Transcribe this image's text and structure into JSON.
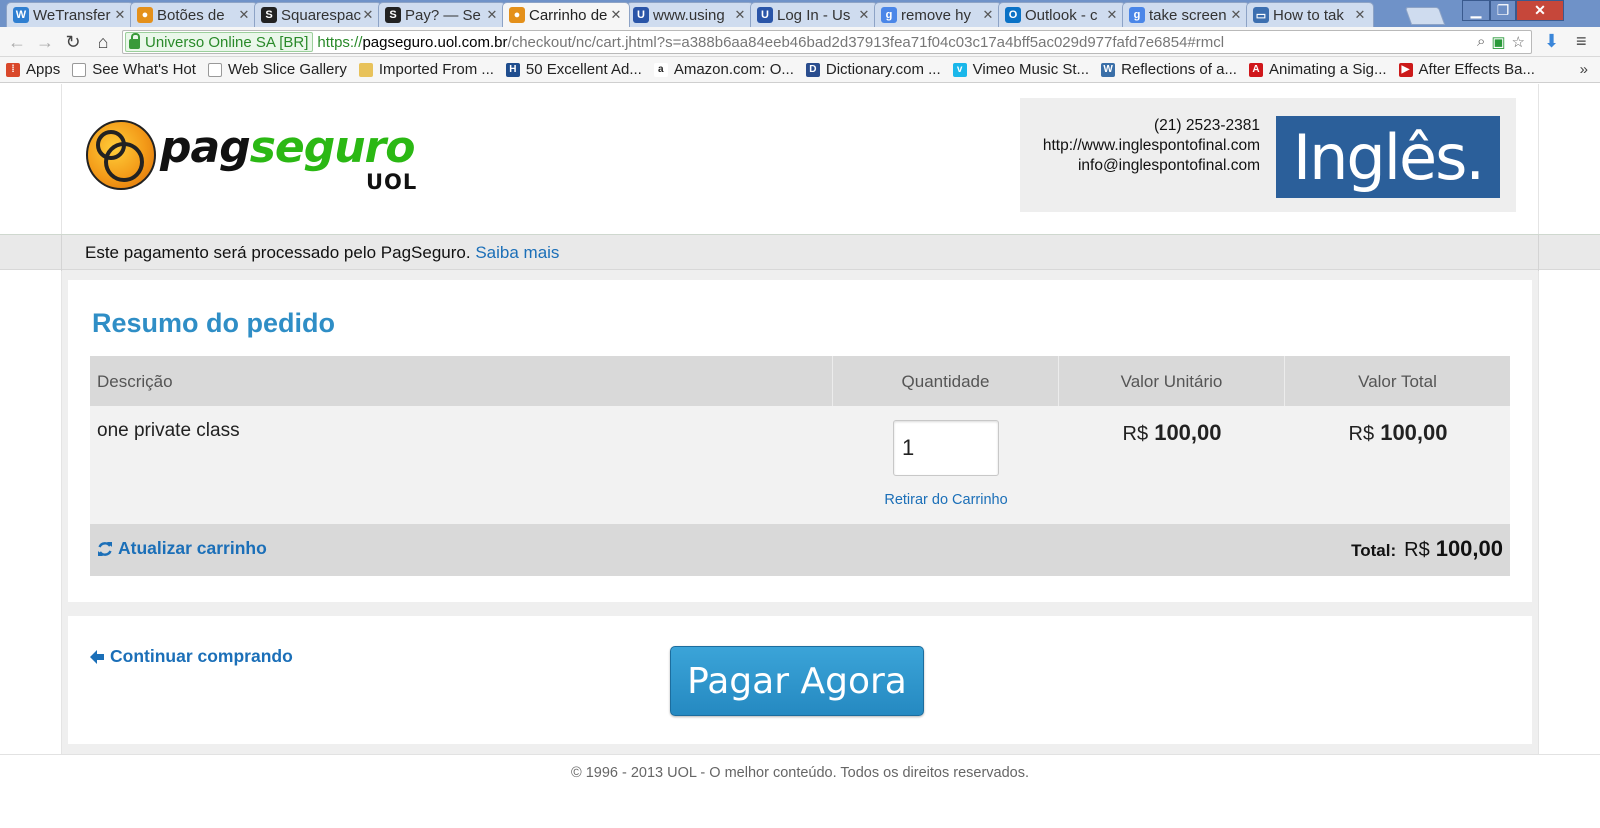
{
  "browser": {
    "tabs": [
      {
        "title": "WeTransfer",
        "favicon": "wetransfer-icon",
        "color": "#2f7fd1"
      },
      {
        "title": "Botões de",
        "favicon": "pagseguro-icon",
        "color": "#e4901a"
      },
      {
        "title": "Squarespace",
        "favicon": "squarespace-icon",
        "color": "#222222"
      },
      {
        "title": "Pay? — Se",
        "favicon": "squarespace-icon",
        "color": "#222222"
      },
      {
        "title": "Carrinho de",
        "favicon": "pagseguro-icon",
        "color": "#e4901a",
        "active": true
      },
      {
        "title": "www.using",
        "favicon": "ue-icon",
        "color": "#2a55a8"
      },
      {
        "title": "Log In - Us",
        "favicon": "ue-icon",
        "color": "#2a55a8"
      },
      {
        "title": "remove hy",
        "favicon": "google-icon",
        "color": "#4a86e8"
      },
      {
        "title": "Outlook - c",
        "favicon": "outlook-icon",
        "color": "#0a72c6"
      },
      {
        "title": "take screen",
        "favicon": "google-icon",
        "color": "#4a86e8"
      },
      {
        "title": "How to tak",
        "favicon": "page-icon",
        "color": "#3c6fb0"
      }
    ],
    "address": {
      "ev_label": "Universo Online SA [BR]",
      "scheme": "https://",
      "host": "pagseguro.uol.com.br",
      "path": "/checkout/nc/cart.jhtml?s=a388b6aa84eeb46bad2d37913fea71f04c03c17a4bff5ac029d977fafd7e6854#rmcl"
    },
    "bookmarks": [
      {
        "label": "Apps",
        "icon": "apps-grid-icon",
        "color": "#d9482b"
      },
      {
        "label": "See What's Hot",
        "icon": "page-icon",
        "color": "#ffffff"
      },
      {
        "label": "Web Slice Gallery",
        "icon": "page-icon",
        "color": "#ffffff"
      },
      {
        "label": "Imported From ...",
        "icon": "folder-icon",
        "color": "#e8c25a"
      },
      {
        "label": "50 Excellent Ad...",
        "icon": "h-icon",
        "color": "#1f4d8e"
      },
      {
        "label": "Amazon.com: O...",
        "icon": "amazon-icon",
        "color": "#222222"
      },
      {
        "label": "Dictionary.com ...",
        "icon": "dictionary-icon",
        "color": "#2a4d8e"
      },
      {
        "label": "Vimeo Music St...",
        "icon": "vimeo-icon",
        "color": "#1ab7ea"
      },
      {
        "label": "Reflections of a...",
        "icon": "wordpress-icon",
        "color": "#3a6fa8"
      },
      {
        "label": "Animating a Sig...",
        "icon": "adobe-icon",
        "color": "#d0171b"
      },
      {
        "label": "After Effects Ba...",
        "icon": "youtube-icon",
        "color": "#cc1a1a"
      }
    ],
    "bookmarks_more": "»"
  },
  "header": {
    "logo_pag": "pag",
    "logo_seguro": "seguro",
    "logo_uol": "UOL",
    "merchant": {
      "phone": "(21) 2523-2381",
      "website": "http://www.inglespontofinal.com",
      "email": "info@inglespontofinal.com",
      "banner_text": "Inglês."
    }
  },
  "notice": {
    "text": "Este pagamento será processado pelo PagSeguro.",
    "link": "Saiba mais"
  },
  "summary": {
    "title": "Resumo do pedido",
    "columns": [
      "Descrição",
      "Quantidade",
      "Valor Unitário",
      "Valor Total"
    ],
    "items": [
      {
        "description": "one private class",
        "quantity": "1",
        "unit_currency": "R$",
        "unit_amount": "100,00",
        "total_currency": "R$",
        "total_amount": "100,00",
        "remove_label": "Retirar do Carrinho"
      }
    ],
    "update_label": "Atualizar carrinho",
    "total_label": "Total:",
    "total_currency": "R$",
    "total_amount": "100,00"
  },
  "actions": {
    "continue_label": "Continuar comprando",
    "pay_label": "Pagar Agora"
  },
  "footer": {
    "text": "© 1996 - 2013 UOL - O melhor conteúdo. Todos os direitos reservados."
  },
  "colors": {
    "accent": "#2f8ec6",
    "link": "#1b6fb8",
    "brand_green": "#2bb814",
    "pay_button": "#2589c1"
  }
}
